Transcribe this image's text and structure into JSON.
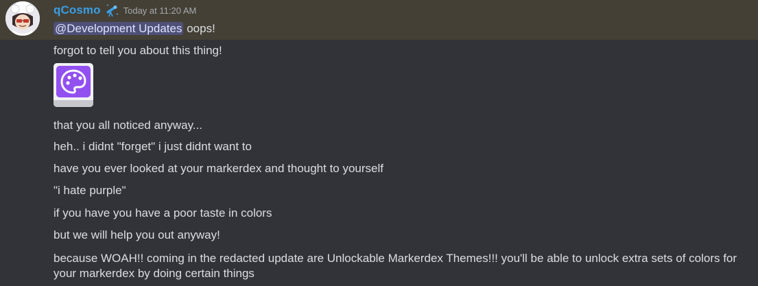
{
  "message": {
    "author": "qCosmo",
    "timestamp": "Today at 11:20 AM",
    "mention": "@Development Updates",
    "first_line_rest": "oops!",
    "lines": [
      "forgot to tell you about this thing!",
      "that you all noticed anyway...",
      "heh.. i didnt \"forget\" i just didnt want to",
      "have you ever looked at your markerdex and thought to yourself",
      "\"i hate purple\"",
      "if you have you have a poor taste in colors",
      "but we will help you out anyway!",
      "because WOAH!! coming in the redacted update are Unlockable Markerdex Themes!!! you'll be able to unlock extra sets of colors for your markerdex by doing certain things"
    ],
    "attachment_icon": "palette-icon",
    "badge_icon": "telescope-icon"
  },
  "colors": {
    "background": "#313338",
    "highlight": "#444036",
    "username": "#3a9ee4",
    "mention_bg": "#4e5077",
    "palette_purple": "#9250f0"
  }
}
